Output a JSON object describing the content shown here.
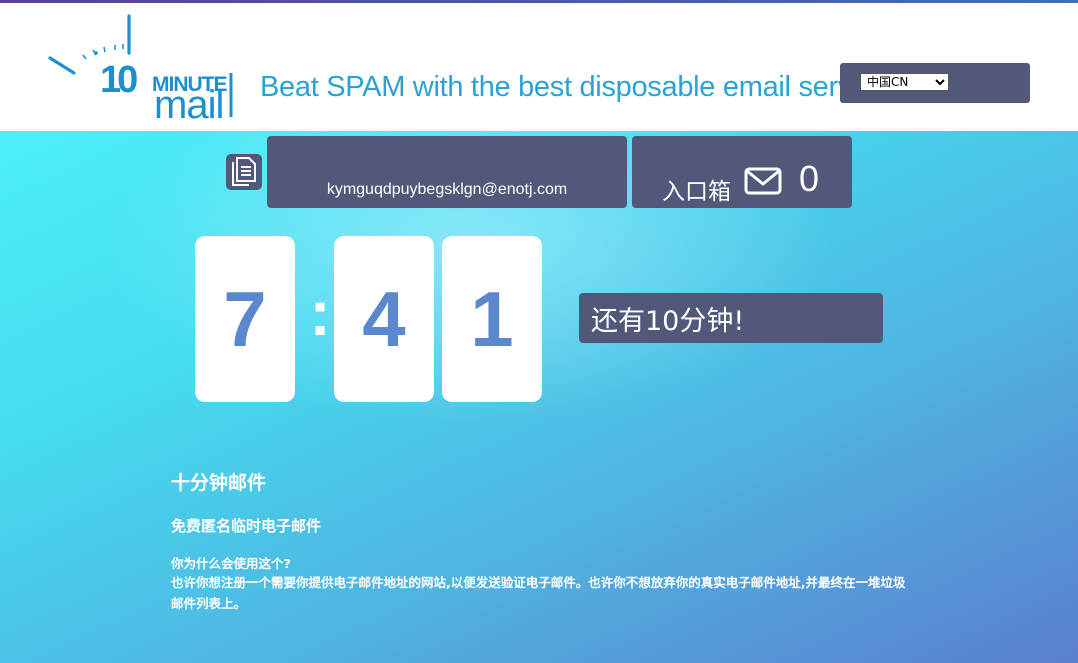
{
  "header": {
    "logo": {
      "line1": "10",
      "line2": "MINUTE",
      "line3": "mail"
    },
    "tagline": "Beat SPAM with the best disposable email service",
    "language": {
      "selected": "中国CN"
    }
  },
  "mailbox": {
    "email": "kymguqdpuybegsklgn@enotj.com",
    "inbox_label": "入口箱",
    "inbox_count": "0"
  },
  "timer": {
    "minutes": "7",
    "separator": ":",
    "seconds_tens": "4",
    "seconds_ones": "1",
    "notice": "还有10分钟!"
  },
  "about": {
    "title": "十分钟邮件",
    "subtitle": "免费匿名临时电子邮件",
    "question": "你为什么会使用这个?",
    "body": "也许你想注册一个需要你提供电子邮件地址的网站,以便发送验证电子邮件。也许你不想放弃你的真实电子邮件地址,并最终在一堆垃圾邮件列表上。"
  },
  "colors": {
    "panel": "#51587a",
    "brand": "#2aa3d3",
    "digit": "#5b88cc"
  },
  "icons": [
    "clock-hand-icon",
    "copy-document-icon",
    "envelope-icon"
  ]
}
